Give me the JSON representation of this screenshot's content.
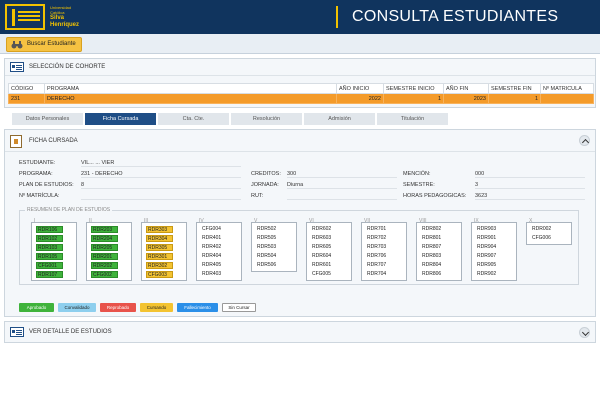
{
  "header": {
    "logo_lines": [
      "Universidad",
      "Católica"
    ],
    "logo_name": [
      "Silva",
      "Henríquez"
    ],
    "title": "CONSULTA ESTUDIANTES"
  },
  "toolbar": {
    "search_label": "Buscar Estudiante"
  },
  "cohort": {
    "title": "SELECCIÓN DE COHORTE",
    "columns": [
      "CÓDIGO",
      "PROGRAMA",
      "AÑO INICIO",
      "SEMESTRE INICIO",
      "AÑO FIN",
      "SEMESTRE FIN",
      "Nº MATRICULA"
    ],
    "row": [
      "231",
      "DERECHO",
      "2022",
      "1",
      "2023",
      "1",
      ""
    ]
  },
  "tabs": [
    "Datos Personales",
    "Ficha Cursada",
    "Cta. Cte.",
    "Resolución",
    "Admisión",
    "Titulación"
  ],
  "ficha": {
    "title": "FICHA CURSADA",
    "labels": {
      "estudiante": "ESTUDIANTE:",
      "programa": "PROGRAMA:",
      "plan": "PLAN DE ESTUDIOS:",
      "matricula": "Nº MATRÍCULA:",
      "creditos": "CREDITOS:",
      "jornada": "JORNADA:",
      "rut": "RUT:",
      "mencion": "MENCIÓN:",
      "semestre": "SEMESTRE:",
      "horas": "HORAS PEDAGOGICAS:"
    },
    "values": {
      "estudiante": "VIL... ... VIER",
      "programa": "231 - DERECHO",
      "plan": "8",
      "matricula": "",
      "creditos": "300",
      "jornada": "Diurna",
      "rut": "",
      "mencion": "000",
      "semestre": "3",
      "horas": "3623"
    },
    "plan_title": "RESUMEN DE PLAN DE ESTUDIOS",
    "semesters": [
      {
        "num": "I",
        "courses": [
          [
            "RDR106",
            "apr"
          ],
          [
            "RDR102",
            "apr"
          ],
          [
            "RDR103",
            "apr"
          ],
          [
            "RDR105",
            "apr"
          ],
          [
            "CFG001",
            "apr"
          ],
          [
            "RDR107",
            "apr"
          ]
        ]
      },
      {
        "num": "II",
        "courses": [
          [
            "RDR203",
            "apr"
          ],
          [
            "RDR204",
            "apr"
          ],
          [
            "RDR205",
            "apr"
          ],
          [
            "RDR201",
            "apr"
          ],
          [
            "RDR202",
            "apr"
          ],
          [
            "CFG002",
            "apr"
          ]
        ]
      },
      {
        "num": "III",
        "courses": [
          [
            "RDR303",
            "cur"
          ],
          [
            "RDR304",
            "cur"
          ],
          [
            "RDR305",
            "cur"
          ],
          [
            "RDR301",
            "cur"
          ],
          [
            "RDR302",
            "cur"
          ],
          [
            "CFG003",
            "cur"
          ]
        ]
      },
      {
        "num": "IV",
        "courses": [
          [
            "CFG004",
            "sin"
          ],
          [
            "RDR401",
            "sin"
          ],
          [
            "RDR402",
            "sin"
          ],
          [
            "RDR404",
            "sin"
          ],
          [
            "RDR405",
            "sin"
          ],
          [
            "RDR403",
            "sin"
          ]
        ]
      },
      {
        "num": "V",
        "courses": [
          [
            "RDR502",
            "sin"
          ],
          [
            "RDR505",
            "sin"
          ],
          [
            "RDR503",
            "sin"
          ],
          [
            "RDR504",
            "sin"
          ],
          [
            "RDR506",
            "sin"
          ]
        ]
      },
      {
        "num": "VI",
        "courses": [
          [
            "RDR602",
            "sin"
          ],
          [
            "RDR603",
            "sin"
          ],
          [
            "RDR605",
            "sin"
          ],
          [
            "RDR604",
            "sin"
          ],
          [
            "RDR601",
            "sin"
          ],
          [
            "CFG005",
            "sin"
          ]
        ]
      },
      {
        "num": "VII",
        "courses": [
          [
            "RDR701",
            "sin"
          ],
          [
            "RDR702",
            "sin"
          ],
          [
            "RDR703",
            "sin"
          ],
          [
            "RDR706",
            "sin"
          ],
          [
            "RDR707",
            "sin"
          ],
          [
            "RDR704",
            "sin"
          ]
        ]
      },
      {
        "num": "VIII",
        "courses": [
          [
            "RDR802",
            "sin"
          ],
          [
            "RDR801",
            "sin"
          ],
          [
            "RDR807",
            "sin"
          ],
          [
            "RDR803",
            "sin"
          ],
          [
            "RDR804",
            "sin"
          ],
          [
            "RDR806",
            "sin"
          ]
        ]
      },
      {
        "num": "IX",
        "courses": [
          [
            "RDR903",
            "sin"
          ],
          [
            "RDR901",
            "sin"
          ],
          [
            "RDR904",
            "sin"
          ],
          [
            "RDR907",
            "sin"
          ],
          [
            "RDR905",
            "sin"
          ],
          [
            "RDR902",
            "sin"
          ]
        ]
      },
      {
        "num": "X",
        "courses": [
          [
            "RDR002",
            "sin"
          ],
          [
            "CFG006",
            "sin"
          ]
        ]
      }
    ],
    "legend": [
      {
        "label": "Aprobado",
        "bg": "#3fb33b",
        "fg": "#ffffff"
      },
      {
        "label": "Convalidado",
        "bg": "#8ecfee",
        "fg": "#222222"
      },
      {
        "label": "Reprobado",
        "bg": "#e8534b",
        "fg": "#ffffff"
      },
      {
        "label": "Cursando",
        "bg": "#f3c331",
        "fg": "#222222"
      },
      {
        "label": "Fallecimiento",
        "bg": "#2b8fe8",
        "fg": "#ffffff"
      },
      {
        "label": "Sin Cursar",
        "bg": "#ffffff",
        "fg": "#222222"
      }
    ]
  },
  "detail": {
    "title": "VER DETALLE DE ESTUDIOS"
  },
  "colors": {
    "navy": "#10345e",
    "gold": "#f2c200",
    "orange_row": "#f49b2a",
    "tab_active": "#1f4e86"
  }
}
